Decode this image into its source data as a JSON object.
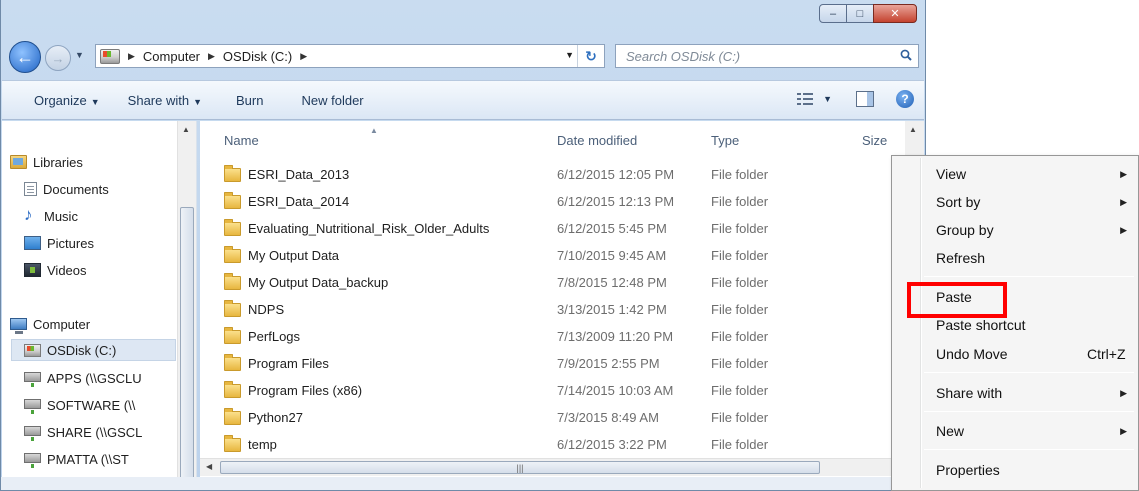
{
  "window": {
    "caption_buttons": {
      "minimize": "–",
      "maximize": "□",
      "close": "✕"
    }
  },
  "nav": {
    "back_glyph": "←",
    "forward_glyph": "→",
    "breadcrumb": [
      "Computer",
      "OSDisk (C:)"
    ],
    "search_placeholder": "Search OSDisk (C:)"
  },
  "toolbar": {
    "organize": "Organize",
    "share_with": "Share with",
    "burn": "Burn",
    "new_folder": "New folder",
    "help_glyph": "?"
  },
  "sidebar": {
    "items": [
      {
        "label": "Libraries",
        "icon": "libraries-icon"
      },
      {
        "label": "Documents",
        "icon": "documents-icon"
      },
      {
        "label": "Music",
        "icon": "music-icon"
      },
      {
        "label": "Pictures",
        "icon": "pictures-icon"
      },
      {
        "label": "Videos",
        "icon": "videos-icon"
      },
      {
        "label": "Computer",
        "icon": "computer-icon"
      },
      {
        "label": "OSDisk (C:)",
        "icon": "drive-icon",
        "selected": true
      },
      {
        "label": "APPS (\\\\GSCLU",
        "icon": "network-drive-icon"
      },
      {
        "label": "SOFTWARE (\\\\",
        "icon": "network-drive-icon"
      },
      {
        "label": "SHARE (\\\\GSCL",
        "icon": "network-drive-icon"
      },
      {
        "label": "PMATTA (\\\\ST",
        "icon": "network-drive-icon"
      }
    ]
  },
  "file_list": {
    "columns": {
      "name": "Name",
      "date": "Date modified",
      "type": "Type",
      "size": "Size"
    },
    "rows": [
      {
        "name": "ESRI_Data_2013",
        "date": "6/12/2015 12:05 PM",
        "type": "File folder"
      },
      {
        "name": "ESRI_Data_2014",
        "date": "6/12/2015 12:13 PM",
        "type": "File folder"
      },
      {
        "name": "Evaluating_Nutritional_Risk_Older_Adults",
        "date": "6/12/2015 5:45 PM",
        "type": "File folder"
      },
      {
        "name": "My Output Data",
        "date": "7/10/2015 9:45 AM",
        "type": "File folder"
      },
      {
        "name": "My Output Data_backup",
        "date": "7/8/2015 12:48 PM",
        "type": "File folder"
      },
      {
        "name": "NDPS",
        "date": "3/13/2015 1:42 PM",
        "type": "File folder"
      },
      {
        "name": "PerfLogs",
        "date": "7/13/2009 11:20 PM",
        "type": "File folder"
      },
      {
        "name": "Program Files",
        "date": "7/9/2015 2:55 PM",
        "type": "File folder"
      },
      {
        "name": "Program Files (x86)",
        "date": "7/14/2015 10:03 AM",
        "type": "File folder"
      },
      {
        "name": "Python27",
        "date": "7/3/2015 8:49 AM",
        "type": "File folder"
      },
      {
        "name": "temp",
        "date": "6/12/2015 3:22 PM",
        "type": "File folder"
      }
    ]
  },
  "context_menu": {
    "items": [
      {
        "label": "View",
        "submenu": true
      },
      {
        "label": "Sort by",
        "submenu": true
      },
      {
        "label": "Group by",
        "submenu": true
      },
      {
        "label": "Refresh"
      },
      {
        "label": "Paste",
        "highlighted": true
      },
      {
        "label": "Paste shortcut"
      },
      {
        "label": "Undo Move",
        "shortcut": "Ctrl+Z"
      },
      {
        "label": "Share with",
        "submenu": true
      },
      {
        "label": "New",
        "submenu": true
      },
      {
        "label": "Properties"
      }
    ]
  },
  "colors": {
    "highlight_box": "#ff0000",
    "window_frame": "#bcd2ec"
  }
}
